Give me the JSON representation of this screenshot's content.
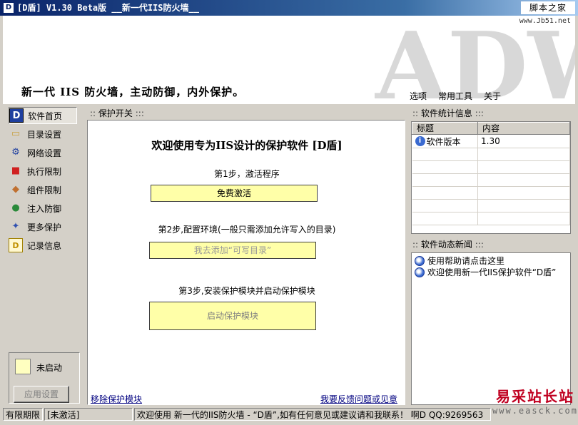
{
  "window": {
    "title": "[D盾] V1.30 Beta版  __新一代IIS防火墙__",
    "corner_logo": "脚本之家",
    "icon_letter": "D"
  },
  "banner": {
    "url": "www.Jb51.net",
    "slogan": "新一代 IIS 防火墙，主动防御，内外保护。",
    "logo_letters": "ADW"
  },
  "menu": [
    "选项",
    "常用工具",
    "关于"
  ],
  "sidebar": {
    "items": [
      {
        "label": "软件首页",
        "icon": "d-shield-icon",
        "glyph": "D"
      },
      {
        "label": "目录设置",
        "icon": "folder-icon",
        "glyph": "▭"
      },
      {
        "label": "网络设置",
        "icon": "network-icon",
        "glyph": "⚙"
      },
      {
        "label": "执行限制",
        "icon": "cubes-icon",
        "glyph": "■"
      },
      {
        "label": "组件限制",
        "icon": "package-icon",
        "glyph": "◆"
      },
      {
        "label": "注入防御",
        "icon": "globe-icon",
        "glyph": "●"
      },
      {
        "label": "更多保护",
        "icon": "satellite-icon",
        "glyph": "✦"
      },
      {
        "label": "记录信息",
        "icon": "log-icon",
        "glyph": "D"
      }
    ],
    "status": "未启动",
    "apply_button": "应用设置"
  },
  "main": {
    "header": "保护开关",
    "welcome": "欢迎使用专为IIS设计的保护软件 [D盾]",
    "step1_label": "第1步，激活程序",
    "step1_button": "免费激活",
    "step2_label": "第2步,配置环境(一般只需添加允许写入的目录)",
    "step2_button": "我去添加“可写目录”",
    "step3_label": "第3步,安装保护模块并启动保护模块",
    "step3_button": "启动保护模块",
    "link_remove": "移除保护模块",
    "link_feedback": "我要反馈问题或见意"
  },
  "stats": {
    "header": "软件统计信息",
    "columns": [
      "标题",
      "内容"
    ],
    "rows": [
      {
        "title": "软件版本",
        "value": "1.30"
      }
    ]
  },
  "news": {
    "header": "软件动态新闻",
    "items": [
      "使用帮助请点击这里",
      "欢迎使用新一代IIS保护软件“D盾”"
    ]
  },
  "statusbar": {
    "period_label": "有限期限",
    "activation": "[未激活]",
    "message": "欢迎使用 新一代的IIS防火墙 - “D盾”,如有任何意见或建议请和我联系！ 啊D  QQ:9269563"
  },
  "watermark": {
    "top": "易采站长站",
    "bottom": "www.easck.com"
  },
  "colors": {
    "titlebar": "#0a246a",
    "button_yellow": "#ffffa8",
    "link": "#000080",
    "watermark_red": "#c00020"
  }
}
